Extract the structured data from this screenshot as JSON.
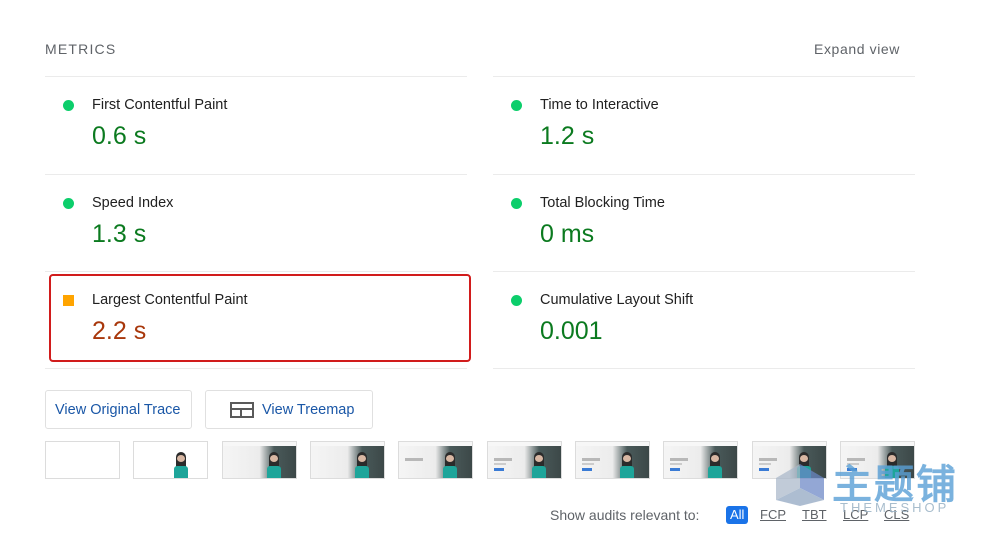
{
  "header": {
    "title": "METRICS",
    "expand_label": "Expand view"
  },
  "metrics": [
    {
      "label": "First Contentful Paint",
      "value": "0.6 s",
      "status": "pass"
    },
    {
      "label": "Time to Interactive",
      "value": "1.2 s",
      "status": "pass"
    },
    {
      "label": "Speed Index",
      "value": "1.3 s",
      "status": "pass"
    },
    {
      "label": "Total Blocking Time",
      "value": "0 ms",
      "status": "pass"
    },
    {
      "label": "Largest Contentful Paint",
      "value": "2.2 s",
      "status": "average"
    },
    {
      "label": "Cumulative Layout Shift",
      "value": "0.001",
      "status": "pass"
    }
  ],
  "buttons": {
    "view_trace": "View Original Trace",
    "view_treemap": "View Treemap"
  },
  "audits": {
    "label": "Show audits relevant to:",
    "filters": [
      "All",
      "FCP",
      "TBT",
      "LCP",
      "CLS"
    ],
    "active": "All"
  },
  "colors": {
    "pass": "#0cce6b",
    "pass_text": "#0b7a1f",
    "average": "#ffa400",
    "average_text": "#a8370b",
    "highlight": "#d11c1c",
    "link": "#1a57a7",
    "active_chip": "#1a73e8"
  },
  "icons": {
    "treemap": "treemap-icon",
    "pass_indicator": "green-circle-icon",
    "average_indicator": "orange-square-icon"
  },
  "watermark": {
    "cn": "主题铺",
    "en": "THEMESHOP"
  }
}
